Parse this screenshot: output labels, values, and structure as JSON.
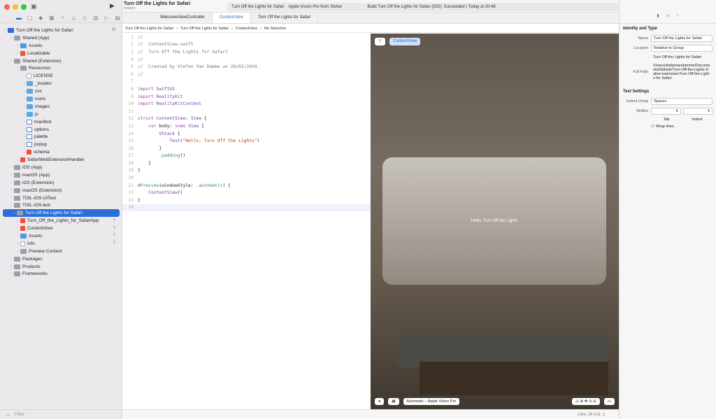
{
  "project": {
    "title": "Turn Off the Lights for Safari",
    "branch": "master"
  },
  "scheme": {
    "target": "Turn Off the Lights for Safari",
    "device": "Apple Vision Pro from Stefan",
    "status": "Build Turn Off the Lights for Safari (iOS): Succeeded | Today at 20:48"
  },
  "tabs": [
    "WelcomeViewController",
    "ContentView",
    "Turn Off the Lights for Safari"
  ],
  "jumpbar": [
    "Turn Off the Lights for Safari",
    "Turn Off the Lights for Safari",
    "ContentView",
    "No Selection"
  ],
  "tree": [
    {
      "label": "Turn Off the Lights for Safari",
      "lvl": 0,
      "ic": "app",
      "st": "M"
    },
    {
      "label": "Shared (App)",
      "lvl": 1,
      "ic": "fgray"
    },
    {
      "label": "Assets",
      "lvl": 2,
      "ic": "asset"
    },
    {
      "label": "Localizable",
      "lvl": 2,
      "ic": "swift"
    },
    {
      "label": "Shared (Extension)",
      "lvl": 1,
      "ic": "fgray"
    },
    {
      "label": "Resources",
      "lvl": 2,
      "ic": "fgray"
    },
    {
      "label": "LICENSE",
      "lvl": 3,
      "ic": "file"
    },
    {
      "label": "_locales",
      "lvl": 3,
      "ic": "folder"
    },
    {
      "label": "css",
      "lvl": 3,
      "ic": "folder"
    },
    {
      "label": "icons",
      "lvl": 3,
      "ic": "folder"
    },
    {
      "label": "images",
      "lvl": 3,
      "ic": "folder"
    },
    {
      "label": "js",
      "lvl": 3,
      "ic": "folder"
    },
    {
      "label": "manifest",
      "lvl": 3,
      "ic": "code"
    },
    {
      "label": "options",
      "lvl": 3,
      "ic": "code"
    },
    {
      "label": "palette",
      "lvl": 3,
      "ic": "code"
    },
    {
      "label": "popup",
      "lvl": 3,
      "ic": "code"
    },
    {
      "label": "schema",
      "lvl": 3,
      "ic": "swift"
    },
    {
      "label": "SafariWebExtensionHandler",
      "lvl": 2,
      "ic": "swift"
    },
    {
      "label": "iOS (App)",
      "lvl": 1,
      "ic": "fgray"
    },
    {
      "label": "macOS (App)",
      "lvl": 1,
      "ic": "fgray"
    },
    {
      "label": "iOS (Extension)",
      "lvl": 1,
      "ic": "fgray"
    },
    {
      "label": "macOS (Extension)",
      "lvl": 1,
      "ic": "fgray"
    },
    {
      "label": "TOtL-iOS-UITest",
      "lvl": 1,
      "ic": "fgray"
    },
    {
      "label": "TOtL-iOS-test",
      "lvl": 1,
      "ic": "fgray"
    },
    {
      "label": "Turn Off the Lights for Safari",
      "lvl": 1,
      "ic": "fgray",
      "sel": true
    },
    {
      "label": "Turn_Off_the_Lights_for_SafariApp",
      "lvl": 2,
      "ic": "swift",
      "st": "?"
    },
    {
      "label": "ContentView",
      "lvl": 2,
      "ic": "swift",
      "st": "?"
    },
    {
      "label": "Assets",
      "lvl": 2,
      "ic": "asset",
      "st": "?"
    },
    {
      "label": "Info",
      "lvl": 2,
      "ic": "file",
      "st": "?"
    },
    {
      "label": "Preview Content",
      "lvl": 2,
      "ic": "fgray"
    },
    {
      "label": "Packages",
      "lvl": 1,
      "ic": "fgray"
    },
    {
      "label": "Products",
      "lvl": 1,
      "ic": "fgray"
    },
    {
      "label": "Frameworks",
      "lvl": 1,
      "ic": "fgray"
    }
  ],
  "filter_placeholder": "Filter",
  "code": [
    "//",
    "//  ContentView.swift",
    "//  Turn Off the Lights for Safari",
    "//",
    "//  Created by Stefan Van Damme on 28/02/2024.",
    "//",
    "",
    "import SwiftUI",
    "import RealityKit",
    "import RealityKitContent",
    "",
    "struct ContentView: View {",
    "    var body: some View {",
    "        VStack {",
    "            Text(\"Hello, Turn Off the Lights\")",
    "        }",
    "        .padding()",
    "    }",
    "}",
    "",
    "#Preview(windowStyle: .automatic) {",
    "    ContentView()",
    "}",
    ""
  ],
  "preview": {
    "chip": "ContentView",
    "hello": "Hello, Turn Off the Lights",
    "device": "Automatic – Apple Vision Pro"
  },
  "status": "Line: 24  Col: 1",
  "inspector": {
    "section1": "Identity and Type",
    "name_label": "Name",
    "name": "Turn Off the Lights for Safari",
    "location_label": "Location",
    "location": "Relative to Group",
    "loc_file": "Turn Off the Lights for Safari",
    "fullpath_label": "Full Path",
    "fullpath": "/Users/stefanvandamme/Documents/GitHub/Turn-Off-the-Lights-Safari-extension/Turn Off the Lights for Safari",
    "section2": "Text Settings",
    "indent_label": "Indent Using",
    "indent": "Spaces",
    "widths_label": "Widths",
    "tab": "4",
    "indentw": "4",
    "tab_label": "Tab",
    "indent_word": "Indent",
    "wrap": "Wrap lines"
  }
}
